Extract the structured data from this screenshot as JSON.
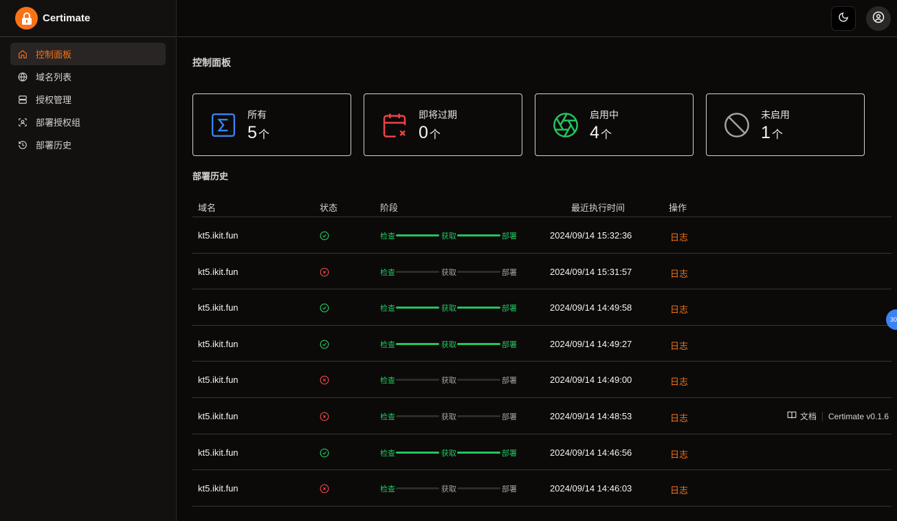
{
  "app": {
    "name": "Certimate",
    "version": "Certimate v0.1.6"
  },
  "nav": [
    {
      "label": "控制面板",
      "icon": "home-icon",
      "active": true
    },
    {
      "label": "域名列表",
      "icon": "globe-icon",
      "active": false
    },
    {
      "label": "授权管理",
      "icon": "server-icon",
      "active": false
    },
    {
      "label": "部署授权组",
      "icon": "scan-group-icon",
      "active": false
    },
    {
      "label": "部署历史",
      "icon": "history-icon",
      "active": false
    }
  ],
  "page": {
    "title": "控制面板",
    "section": "部署历史"
  },
  "cards": [
    {
      "label": "所有",
      "value": "5",
      "unit": "个",
      "icon": "sigma-icon",
      "color": "#3b82f6"
    },
    {
      "label": "即将过期",
      "value": "0",
      "unit": "个",
      "icon": "calendar-x-icon",
      "color": "#ef4444"
    },
    {
      "label": "启用中",
      "value": "4",
      "unit": "个",
      "icon": "aperture-icon",
      "color": "#22c55e"
    },
    {
      "label": "未启用",
      "value": "1",
      "unit": "个",
      "icon": "ban-icon",
      "color": "#a3a3a3"
    }
  ],
  "table": {
    "headers": [
      "域名",
      "状态",
      "阶段",
      "最近执行时间",
      "操作"
    ],
    "stage_labels": [
      "检查",
      "获取",
      "部署"
    ],
    "rows": [
      {
        "domain": "kt5.ikit.fun",
        "status": "success",
        "time": "2024/09/14 15:32:36",
        "action": "日志"
      },
      {
        "domain": "kt5.ikit.fun",
        "status": "failed",
        "time": "2024/09/14 15:31:57",
        "action": "日志"
      },
      {
        "domain": "kt5.ikit.fun",
        "status": "success",
        "time": "2024/09/14 14:49:58",
        "action": "日志"
      },
      {
        "domain": "kt5.ikit.fun",
        "status": "success",
        "time": "2024/09/14 14:49:27",
        "action": "日志"
      },
      {
        "domain": "kt5.ikit.fun",
        "status": "failed",
        "time": "2024/09/14 14:49:00",
        "action": "日志"
      },
      {
        "domain": "kt5.ikit.fun",
        "status": "failed",
        "time": "2024/09/14 14:48:53",
        "action": "日志"
      },
      {
        "domain": "kt5.ikit.fun",
        "status": "success",
        "time": "2024/09/14 14:46:56",
        "action": "日志"
      },
      {
        "domain": "kt5.ikit.fun",
        "status": "failed",
        "time": "2024/09/14 14:46:03",
        "action": "日志"
      }
    ]
  },
  "footer": {
    "docs": "文档"
  },
  "floater": {
    "text": "30"
  },
  "colors": {
    "accent": "#f97316",
    "success": "#22c55e",
    "error": "#ef4444"
  }
}
